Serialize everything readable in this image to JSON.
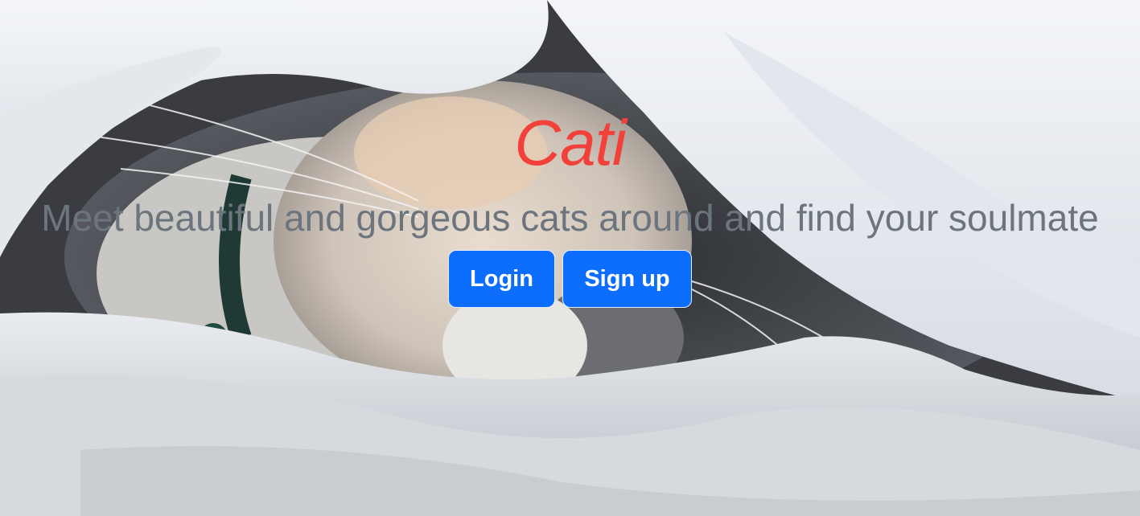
{
  "hero": {
    "title": "Cati",
    "tagline": "Meet beautiful and gorgeous cats around and find your soulmate",
    "background_image": "cat-under-blanket"
  },
  "actions": {
    "login_label": "Login",
    "signup_label": "Sign up"
  },
  "colors": {
    "title": "#f2413a",
    "tagline": "#6c757d",
    "button": "#0d6efd",
    "blanket": "#e6e9ee"
  }
}
